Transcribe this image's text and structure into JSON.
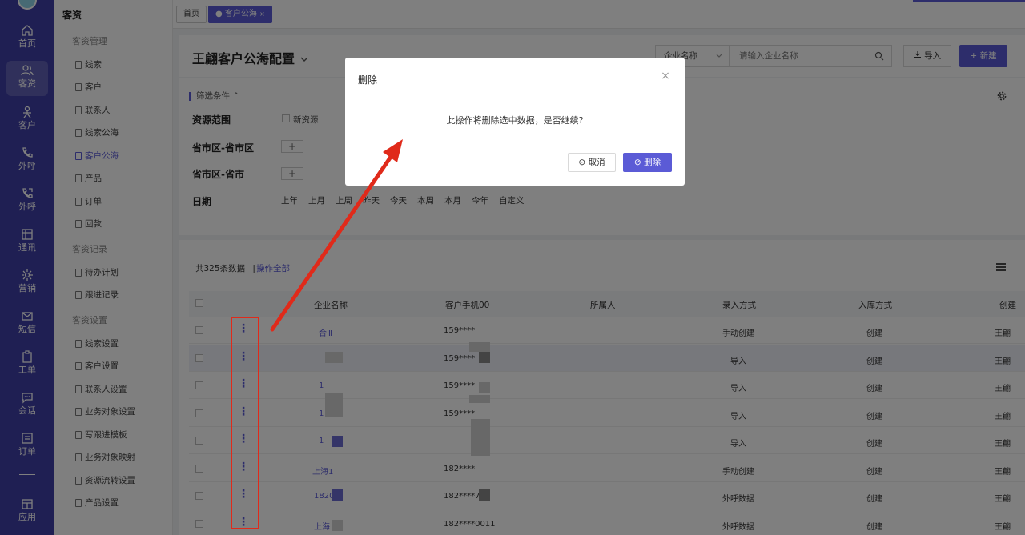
{
  "nav": {
    "items": [
      {
        "label": "首页",
        "icon": "home-icon"
      },
      {
        "label": "客资",
        "icon": "users-icon",
        "active": true
      },
      {
        "label": "客户",
        "icon": "person-icon"
      },
      {
        "label": "外呼",
        "icon": "phone-icon"
      },
      {
        "label": "外呼",
        "icon": "phone-out-icon"
      },
      {
        "label": "通讯",
        "icon": "addressbook-icon"
      },
      {
        "label": "营销",
        "icon": "gear-icon"
      },
      {
        "label": "短信",
        "icon": "mail-icon"
      },
      {
        "label": "工单",
        "icon": "clipboard-icon"
      },
      {
        "label": "会话",
        "icon": "chat-icon"
      },
      {
        "label": "订单",
        "icon": "list-icon"
      },
      {
        "label": "应用",
        "icon": "apps-icon"
      }
    ]
  },
  "subnav": {
    "title": "客资",
    "groups": [
      {
        "label": "客资管理",
        "items": [
          "线索",
          "客户",
          "联系人",
          "线索公海",
          "客户公海",
          "产品",
          "订单",
          "回款"
        ]
      },
      {
        "label": "客资记录",
        "items": [
          "待办计划",
          "跟进记录"
        ]
      },
      {
        "label": "客资设置",
        "items": [
          "线索设置",
          "客户设置",
          "联系人设置",
          "业务对象设置",
          "写跟进模板",
          "业务对象映射",
          "资源流转设置",
          "产品设置"
        ]
      }
    ],
    "active_item": "客户公海"
  },
  "tabs": [
    {
      "label": "首页"
    },
    {
      "label": "客户公海",
      "close": "×"
    }
  ],
  "page": {
    "title": "王翩客户公海配置",
    "search_select": "企业名称",
    "search_placeholder": "请输入企业名称",
    "import_label": "导入",
    "new_label": "新建"
  },
  "filters": {
    "toggle_label": "筛选条件",
    "resource_label": "资源范围",
    "resource_option": "新资源",
    "region1_label": "省市区-省市区",
    "region2_label": "省市区-省市",
    "date_label": "日期",
    "date_options": [
      "上年",
      "上月",
      "上周",
      "昨天",
      "今天",
      "本周",
      "本月",
      "今年",
      "自定义"
    ]
  },
  "table": {
    "count_text": "共325条数据",
    "separator": "|",
    "op_all": "操作全部",
    "headers": [
      "企业名称",
      "客户手机00",
      "所属人",
      "录入方式",
      "入库方式",
      "创建"
    ],
    "rows": [
      {
        "company": "合Ⅲ",
        "phone": "159****",
        "entry": "手动创建",
        "storage": "创建",
        "creator": "王翩"
      },
      {
        "company": "",
        "phone": "159****",
        "entry": "导入",
        "storage": "创建",
        "creator": "王翩"
      },
      {
        "company": "1",
        "phone": "159****",
        "entry": "导入",
        "storage": "创建",
        "creator": "王翩"
      },
      {
        "company": "1",
        "phone": "159****",
        "entry": "导入",
        "storage": "创建",
        "creator": "王翩"
      },
      {
        "company": "1",
        "phone": "",
        "entry": "导入",
        "storage": "创建",
        "creator": "王翩"
      },
      {
        "company": "上海1",
        "phone": "182****",
        "entry": "手动创建",
        "storage": "创建",
        "creator": "王翩"
      },
      {
        "company": "1820",
        "phone": "182****79",
        "entry": "外呼数据",
        "storage": "创建",
        "creator": "王翩"
      },
      {
        "company": "上海",
        "phone": "182****0011",
        "entry": "外呼数据",
        "storage": "创建",
        "creator": "王翩"
      }
    ]
  },
  "dialog": {
    "title": "删除",
    "close": "×",
    "message": "此操作将删除选中数据，是否继续?",
    "cancel_label": "取消",
    "confirm_label": "删除"
  },
  "colors": {
    "primary": "#5b5bd6",
    "nav_bg": "#3f3fa6",
    "annotation": "#e02a1a"
  }
}
